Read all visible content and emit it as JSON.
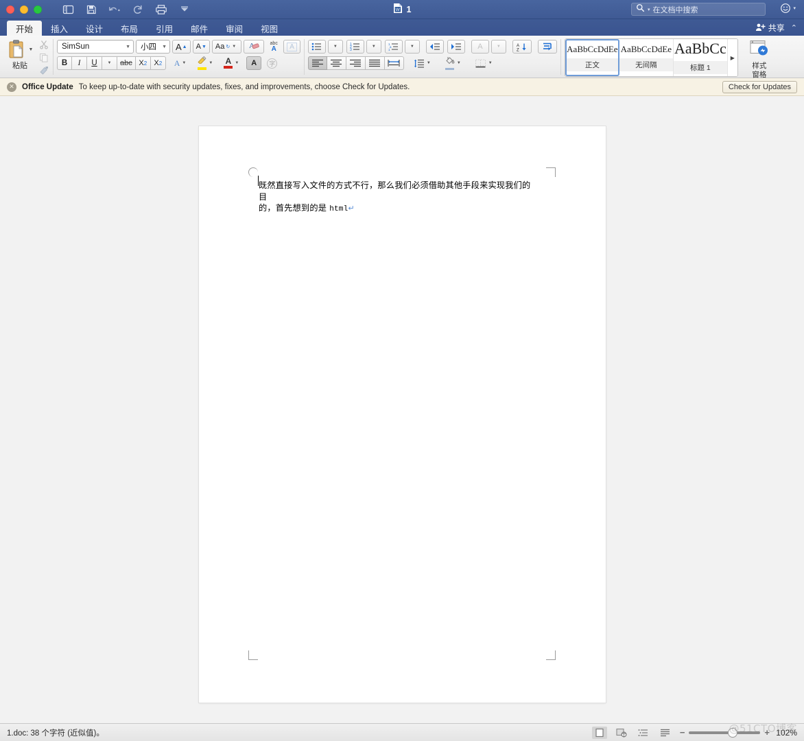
{
  "titlebar": {
    "document_name": "1",
    "search_placeholder": "在文档中搜索",
    "quick_access": [
      {
        "name": "sidebar-toggle",
        "label": "显示/隐藏侧边栏"
      },
      {
        "name": "save",
        "label": "保存"
      },
      {
        "name": "undo",
        "label": "撤消"
      },
      {
        "name": "redo",
        "label": "重做"
      },
      {
        "name": "print",
        "label": "打印"
      },
      {
        "name": "customize",
        "label": "自定义快速访问工具栏"
      }
    ]
  },
  "tabs": [
    {
      "label": "开始",
      "active": true
    },
    {
      "label": "插入",
      "active": false
    },
    {
      "label": "设计",
      "active": false
    },
    {
      "label": "布局",
      "active": false
    },
    {
      "label": "引用",
      "active": false
    },
    {
      "label": "邮件",
      "active": false
    },
    {
      "label": "审阅",
      "active": false
    },
    {
      "label": "视图",
      "active": false
    }
  ],
  "share": {
    "label": "共享"
  },
  "ribbon": {
    "clipboard": {
      "paste_label": "粘贴",
      "cut_label": "剪切",
      "copy_label": "复制",
      "format_painter_label": "格式刷"
    },
    "font": {
      "font_name": "SimSun",
      "font_size": "小四",
      "grow_label": "A",
      "shrink_label": "A",
      "change_case_label": "Aa",
      "clear_format_label": "A",
      "phonetic_label": "abc",
      "border_label": "A",
      "bold_label": "B",
      "italic_label": "I",
      "underline_label": "U",
      "strike_label": "abc",
      "subscript_label": "X",
      "subscript_sub": "2",
      "superscript_label": "X",
      "superscript_sup": "2",
      "text_effects_label": "A",
      "highlight_label": "",
      "font_color_label": "A",
      "char_shading_label": "A",
      "enclose_char_label": "字"
    },
    "paragraph": {
      "bullets_label": "项目符号",
      "numbering_label": "编号",
      "multilevel_label": "多级列表",
      "decrease_indent_label": "减少缩进量",
      "increase_indent_label": "增加缩进量",
      "ltr_rtl_label": "A",
      "sort_label": "AZ",
      "show_marks_label": "显示编辑标记",
      "align_left_label": "左对齐",
      "align_center_label": "居中",
      "align_right_label": "右对齐",
      "justify_label": "两端对齐",
      "distribute_label": "分散对齐",
      "line_spacing_label": "行和段落间距",
      "shading_label": "底纹",
      "borders_label": "边框"
    },
    "styles": {
      "gallery": [
        {
          "preview": "AaBbCcDdEe",
          "name": "正文",
          "selected": true,
          "size": "13px"
        },
        {
          "preview": "AaBbCcDdEe",
          "name": "无间隔",
          "selected": false,
          "size": "13px"
        },
        {
          "preview": "AaBbCc",
          "name": "标题 1",
          "selected": false,
          "size": "22px"
        }
      ],
      "more_label": "▶",
      "pane_label_line1": "样式",
      "pane_label_line2": "窗格"
    }
  },
  "notification": {
    "title": "Office Update",
    "message": "To keep up-to-date with security updates, fixes, and improvements, choose Check for Updates.",
    "button_label": "Check for Updates",
    "close_label": "✕"
  },
  "document": {
    "body_line1": "既然直接写入文件的方式不行，那么我们必须借助其他手段来实现我们的目",
    "body_line2_cjk": "的，首先想到的是 ",
    "body_line2_latin": "html",
    "paragraph_mark": "↵"
  },
  "statusbar": {
    "left_text": "1.doc: 38 个字符 (近似值)。",
    "views": [
      {
        "name": "print-layout",
        "selected": true
      },
      {
        "name": "web-layout",
        "selected": false
      },
      {
        "name": "outline",
        "selected": false
      },
      {
        "name": "draft",
        "selected": false
      }
    ],
    "zoom_out_label": "−",
    "zoom_in_label": "+",
    "zoom_percent": "102%"
  },
  "watermark": "@51CTO博客",
  "colors": {
    "titlebar_blue": "#3f5a94",
    "tab_active_bg": "#f5f5f5",
    "notice_bg": "#f7f2e4",
    "style_selected_border": "#6f9cd8",
    "accent_blue": "#1f6fd4",
    "highlight_yellow": "#ffe400",
    "font_color_red": "#d4241a"
  }
}
